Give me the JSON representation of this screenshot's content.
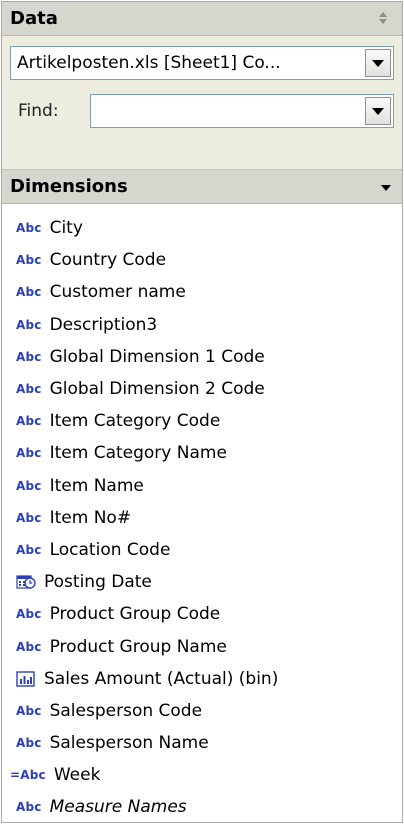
{
  "data_section": {
    "header": "Data",
    "source_value": "Artikelposten.xls [Sheet1] Co...",
    "find_label": "Find:",
    "find_value": ""
  },
  "dimensions": {
    "header": "Dimensions",
    "type_label": "Abc",
    "items": [
      {
        "label": "City",
        "type": "string"
      },
      {
        "label": "Country Code",
        "type": "string"
      },
      {
        "label": "Customer name",
        "type": "string"
      },
      {
        "label": "Description3",
        "type": "string"
      },
      {
        "label": "Global Dimension 1 Code",
        "type": "string"
      },
      {
        "label": "Global Dimension 2 Code",
        "type": "string"
      },
      {
        "label": "Item Category Code",
        "type": "string"
      },
      {
        "label": "Item Category Name",
        "type": "string"
      },
      {
        "label": "Item Name",
        "type": "string"
      },
      {
        "label": "Item No#",
        "type": "string"
      },
      {
        "label": "Location Code",
        "type": "string"
      },
      {
        "label": "Posting Date",
        "type": "date"
      },
      {
        "label": "Product Group Code",
        "type": "string"
      },
      {
        "label": "Product Group Name",
        "type": "string"
      },
      {
        "label": "Sales Amount (Actual) (bin)",
        "type": "bin"
      },
      {
        "label": "Salesperson Code",
        "type": "string"
      },
      {
        "label": "Salesperson Name",
        "type": "string"
      },
      {
        "label": "Week",
        "type": "calculated",
        "prefix": "="
      },
      {
        "label": "Measure Names",
        "type": "string",
        "italic": true
      }
    ]
  },
  "colors": {
    "header_bg": "#d6d6cf",
    "data_bg": "#ececdf",
    "abc_blue": "#2a3fb8"
  }
}
